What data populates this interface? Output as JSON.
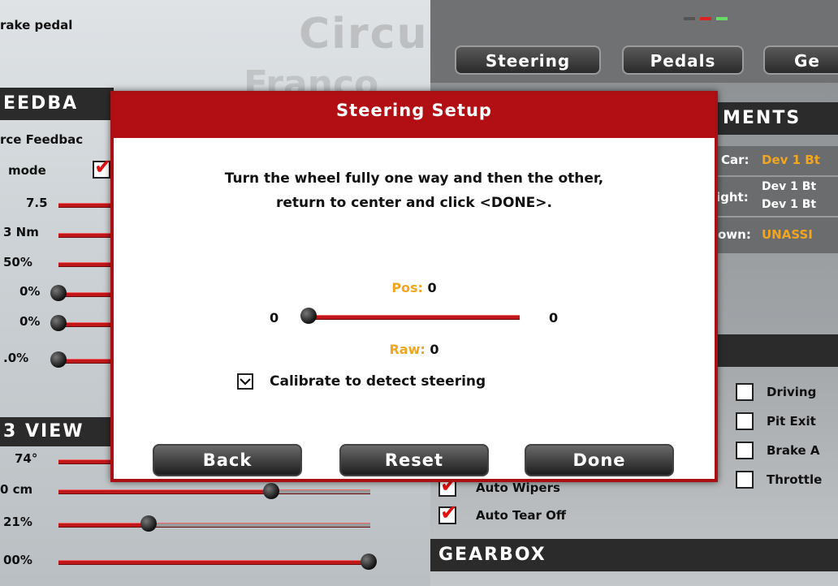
{
  "background": {
    "watermark_1": "Circu",
    "watermark_2": "Franco",
    "brake_pedal_label": "rake pedal",
    "feedback_header": "EEDBA",
    "force_feedback_label": "rce Feedbac",
    "mode_label": "mode",
    "view_header": "VIEW",
    "view_header_prefix": "3",
    "left_values": [
      "7.5",
      "3 Nm",
      "50%",
      "0%",
      "0%",
      ".0%"
    ],
    "view_values": [
      "74°",
      "0 cm",
      "21%",
      "00%"
    ],
    "view_slider_levels": [
      0.15,
      0.69,
      0.28,
      1.0
    ]
  },
  "tabs": [
    {
      "label": "Steering"
    },
    {
      "label": "Pedals"
    },
    {
      "label": "Ge"
    }
  ],
  "assignments": {
    "header": "MENTS",
    "rows": [
      {
        "label": "Car:",
        "value": "Dev 1 Bt"
      },
      {
        "label": "ight:",
        "value_1": "Dev 1 Bt",
        "value_2": "Dev 1 Bt"
      },
      {
        "label": "own:",
        "value": "UNASSI"
      }
    ]
  },
  "options": [
    {
      "label": "Driving"
    },
    {
      "label": "Pit Exit"
    },
    {
      "label": "Brake A"
    },
    {
      "label": "Throttle"
    }
  ],
  "auto_options": [
    {
      "label": "Auto Wipers",
      "checked": true
    },
    {
      "label": "Auto Tear Off",
      "checked": true
    }
  ],
  "gearbox_header": "GEARBOX",
  "modal": {
    "title": "Steering Setup",
    "instruction_line1": "Turn the wheel fully one way and then the other,",
    "instruction_line2": "return to center and click <DONE>.",
    "pos_label": "Pos:",
    "pos_value": "0",
    "slider_min": "0",
    "slider_max": "0",
    "slider_level": 0.0,
    "raw_label": "Raw:",
    "raw_value": "0",
    "calibrate_label": "Calibrate to detect steering",
    "calibrate_checked": true,
    "buttons": {
      "back": "Back",
      "reset": "Reset",
      "done": "Done"
    }
  },
  "colors": {
    "modal_red": "#b10f13",
    "accent_orange": "#f2a51f",
    "slider_red": "#c0171b"
  }
}
